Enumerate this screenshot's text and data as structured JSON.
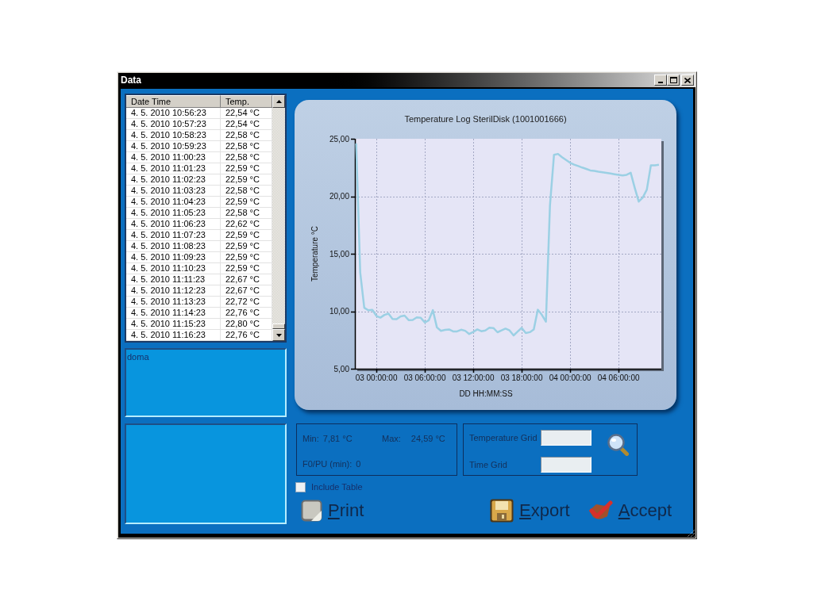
{
  "window": {
    "title": "Data"
  },
  "table": {
    "columns": [
      "Date Time",
      "Temp."
    ],
    "rows": [
      [
        "4. 5. 2010 10:56:23",
        "22,54 °C"
      ],
      [
        "4. 5. 2010 10:57:23",
        "22,54 °C"
      ],
      [
        "4. 5. 2010 10:58:23",
        "22,58 °C"
      ],
      [
        "4. 5. 2010 10:59:23",
        "22,58 °C"
      ],
      [
        "4. 5. 2010 11:00:23",
        "22,58 °C"
      ],
      [
        "4. 5. 2010 11:01:23",
        "22,59 °C"
      ],
      [
        "4. 5. 2010 11:02:23",
        "22,59 °C"
      ],
      [
        "4. 5. 2010 11:03:23",
        "22,58 °C"
      ],
      [
        "4. 5. 2010 11:04:23",
        "22,59 °C"
      ],
      [
        "4. 5. 2010 11:05:23",
        "22,58 °C"
      ],
      [
        "4. 5. 2010 11:06:23",
        "22,62 °C"
      ],
      [
        "4. 5. 2010 11:07:23",
        "22,59 °C"
      ],
      [
        "4. 5. 2010 11:08:23",
        "22,59 °C"
      ],
      [
        "4. 5. 2010 11:09:23",
        "22,59 °C"
      ],
      [
        "4. 5. 2010 11:10:23",
        "22,59 °C"
      ],
      [
        "4. 5. 2010 11:11:23",
        "22,67 °C"
      ],
      [
        "4. 5. 2010 11:12:23",
        "22,67 °C"
      ],
      [
        "4. 5. 2010 11:13:23",
        "22,72 °C"
      ],
      [
        "4. 5. 2010 11:14:23",
        "22,76 °C"
      ],
      [
        "4. 5. 2010 11:15:23",
        "22,80 °C"
      ],
      [
        "4. 5. 2010 11:16:23",
        "22,76 °C"
      ]
    ]
  },
  "note": {
    "value": "doma"
  },
  "chart": {
    "chart_data": {
      "type": "line",
      "title": "Temperature Log SterilDisk (1001001666)",
      "xlabel": "DD HH:MM:SS",
      "ylabel": "Temperature °C",
      "categories": [
        null,
        null,
        null,
        null,
        null,
        "03 00:00:00",
        null,
        null,
        null,
        null,
        null,
        null,
        null,
        null,
        null,
        null,
        null,
        "03 06:00:00",
        null,
        null,
        null,
        null,
        null,
        null,
        null,
        null,
        null,
        null,
        null,
        "03 12:00:00",
        null,
        null,
        null,
        null,
        null,
        null,
        null,
        null,
        null,
        null,
        null,
        "03 18:00:00",
        null,
        null,
        null,
        null,
        null,
        null,
        null,
        null,
        null,
        null,
        null,
        "04 00:00:00",
        null,
        null,
        null,
        null,
        null,
        null,
        null,
        null,
        null,
        null,
        null,
        "04 06:00:00",
        null,
        null,
        null,
        null,
        null,
        null,
        null,
        null,
        null,
        null
      ],
      "series": [
        {
          "color": "#9bd0e4",
          "values": [
            24.59,
            13.37,
            10.3,
            10.08,
            10.12,
            9.6,
            9.44,
            9.68,
            9.79,
            9.33,
            9.3,
            9.56,
            9.62,
            9.23,
            9.24,
            9.46,
            9.43,
            9.03,
            9.22,
            10.1,
            8.59,
            8.29,
            8.38,
            8.42,
            8.25,
            8.25,
            8.39,
            8.3,
            8.02,
            8.2,
            8.42,
            8.26,
            8.33,
            8.57,
            8.54,
            8.17,
            8.33,
            8.49,
            8.33,
            7.9,
            8.23,
            8.55,
            8.1,
            8.18,
            8.42,
            10.13,
            9.68,
            9.1,
            19.21,
            23.61,
            23.68,
            23.39,
            23.15,
            22.91,
            22.75,
            22.63,
            22.5,
            22.38,
            22.25,
            22.2,
            22.14,
            22.09,
            22.04,
            21.98,
            21.92,
            21.86,
            21.81,
            21.87,
            22.04,
            20.75,
            19.54,
            19.89,
            20.58,
            22.69,
            22.68,
            22.74
          ]
        }
      ],
      "ylim": [
        5,
        25
      ],
      "yticks": [
        {
          "value": 5,
          "label": "5,00"
        },
        {
          "value": 10,
          "label": "10,00"
        },
        {
          "value": 15,
          "label": "15,00"
        },
        {
          "value": 20,
          "label": "20,00"
        },
        {
          "value": 25,
          "label": "25,00"
        }
      ],
      "grid": true
    }
  },
  "stats": [
    {
      "label": "Min:",
      "value": "7,81 °C"
    },
    {
      "label": "Max:",
      "value": "24,59 °C"
    },
    {
      "label": "F0/PU (min):",
      "value": "0"
    }
  ],
  "grid_fields": [
    {
      "label": "Temperature Grid"
    },
    {
      "label": "Time Grid"
    }
  ],
  "include_table": {
    "label": "Include Table",
    "checked": false
  },
  "buttons": [
    {
      "label": "Print",
      "kind": "print"
    },
    {
      "label": "Export",
      "kind": "export"
    },
    {
      "label": "Accept",
      "kind": "accept"
    }
  ]
}
